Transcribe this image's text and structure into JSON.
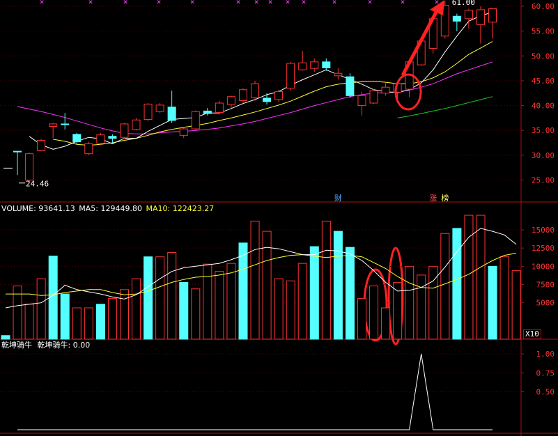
{
  "colors": {
    "up": "#ff3333",
    "down": "#55ffff",
    "ma_white": "#ffffff",
    "ma_yellow": "#ffff33",
    "ma_magenta": "#ff33ff",
    "ma_green": "#22cc22",
    "axis": "#b01010",
    "annotation": "#ff2222"
  },
  "price_panel": {
    "high_label": "61.00",
    "low_label": "24.46",
    "y_ticks": [
      "60.00",
      "55.00",
      "50.00",
      "45.00",
      "40.00",
      "35.00",
      "30.00",
      "25.00"
    ],
    "markers": [
      {
        "text": "财",
        "index": 27,
        "color": "#55aaff"
      },
      {
        "text": "涨",
        "index": 35,
        "color": "#ff5555"
      },
      {
        "text": "榜",
        "index": 36,
        "color": "#ffff66"
      }
    ]
  },
  "volume_panel": {
    "label": "VOLUME:",
    "volume": "93641.13",
    "ma5_label": "MA5:",
    "ma5": "129449.80",
    "ma10_label": "MA10:",
    "ma10": "122423.27",
    "y_ticks": [
      "15000",
      "12500",
      "10000",
      "7500",
      "5000"
    ],
    "unit": "X10"
  },
  "indicator_panel": {
    "name": "乾坤骑牛",
    "name2": "乾坤骑牛:",
    "value": "0.00",
    "y_ticks": [
      "1.00",
      "0.75",
      "0.50"
    ]
  },
  "chart_data": [
    {
      "type": "candlestick",
      "title": "",
      "ylim": [
        23,
        62
      ],
      "series": [
        {
          "o": 30.8,
          "h": 30.8,
          "l": 26.0,
          "c": 30.8,
          "up": false
        },
        {
          "o": 25.0,
          "h": 30.5,
          "l": 24.5,
          "c": 30.3,
          "up": true
        },
        {
          "o": 30.9,
          "h": 33.3,
          "l": 30.8,
          "c": 33.0,
          "up": true
        },
        {
          "o": 35.8,
          "h": 36.5,
          "l": 33.5,
          "c": 36.3,
          "up": true
        },
        {
          "o": 36.2,
          "h": 38.5,
          "l": 35.2,
          "c": 36.3,
          "up": false
        },
        {
          "o": 34.2,
          "h": 34.5,
          "l": 32.3,
          "c": 32.7,
          "up": false
        },
        {
          "o": 30.3,
          "h": 32.7,
          "l": 30.0,
          "c": 32.3,
          "up": true
        },
        {
          "o": 32.4,
          "h": 34.5,
          "l": 32.0,
          "c": 34.1,
          "up": true
        },
        {
          "o": 33.8,
          "h": 34.2,
          "l": 32.5,
          "c": 33.4,
          "up": false
        },
        {
          "o": 33.6,
          "h": 36.5,
          "l": 33.3,
          "c": 36.3,
          "up": true
        },
        {
          "o": 35.2,
          "h": 37.5,
          "l": 35.0,
          "c": 37.1,
          "up": true
        },
        {
          "o": 37.2,
          "h": 40.5,
          "l": 36.8,
          "c": 40.3,
          "up": true
        },
        {
          "o": 38.8,
          "h": 40.5,
          "l": 38.5,
          "c": 40.1,
          "up": true
        },
        {
          "o": 39.7,
          "h": 43.0,
          "l": 36.5,
          "c": 37.0,
          "up": false
        },
        {
          "o": 34.0,
          "h": 35.5,
          "l": 33.5,
          "c": 35.3,
          "up": true
        },
        {
          "o": 35.3,
          "h": 39.0,
          "l": 35.0,
          "c": 38.8,
          "up": true
        },
        {
          "o": 38.9,
          "h": 39.5,
          "l": 38.0,
          "c": 38.4,
          "up": false
        },
        {
          "o": 38.6,
          "h": 40.9,
          "l": 38.2,
          "c": 40.5,
          "up": true
        },
        {
          "o": 40.2,
          "h": 42.0,
          "l": 39.5,
          "c": 41.8,
          "up": true
        },
        {
          "o": 41.0,
          "h": 43.5,
          "l": 40.5,
          "c": 43.2,
          "up": true
        },
        {
          "o": 41.6,
          "h": 45.0,
          "l": 41.0,
          "c": 44.4,
          "up": true
        },
        {
          "o": 41.5,
          "h": 42.5,
          "l": 40.2,
          "c": 40.8,
          "up": false
        },
        {
          "o": 41.2,
          "h": 43.2,
          "l": 40.8,
          "c": 42.8,
          "up": true
        },
        {
          "o": 43.5,
          "h": 48.8,
          "l": 43.0,
          "c": 48.5,
          "up": true
        },
        {
          "o": 47.2,
          "h": 51.0,
          "l": 47.0,
          "c": 48.6,
          "up": true
        },
        {
          "o": 47.5,
          "h": 49.5,
          "l": 46.8,
          "c": 48.8,
          "up": true
        },
        {
          "o": 48.8,
          "h": 49.5,
          "l": 47.0,
          "c": 47.6,
          "up": false
        },
        {
          "o": 46.0,
          "h": 47.5,
          "l": 45.2,
          "c": 46.5,
          "up": true
        },
        {
          "o": 45.8,
          "h": 46.5,
          "l": 41.5,
          "c": 42.0,
          "up": false
        },
        {
          "o": 40.0,
          "h": 42.8,
          "l": 38.0,
          "c": 42.0,
          "up": true
        },
        {
          "o": 40.5,
          "h": 43.3,
          "l": 40.3,
          "c": 43.0,
          "up": true
        },
        {
          "o": 42.5,
          "h": 44.5,
          "l": 42.0,
          "c": 43.7,
          "up": true
        },
        {
          "o": 42.7,
          "h": 44.8,
          "l": 40.5,
          "c": 44.4,
          "up": true
        },
        {
          "o": 43.3,
          "h": 49.0,
          "l": 41.7,
          "c": 48.8,
          "up": true
        },
        {
          "o": 48.2,
          "h": 53.5,
          "l": 48.0,
          "c": 53.0,
          "up": true
        },
        {
          "o": 51.5,
          "h": 58.0,
          "l": 50.5,
          "c": 57.5,
          "up": true
        },
        {
          "o": 54.0,
          "h": 61.0,
          "l": 53.5,
          "c": 60.2,
          "up": true
        },
        {
          "o": 58.0,
          "h": 58.5,
          "l": 55.0,
          "c": 57.0,
          "up": false
        },
        {
          "o": 57.5,
          "h": 59.5,
          "l": 55.5,
          "c": 59.2,
          "up": true
        },
        {
          "o": 56.3,
          "h": 60.0,
          "l": 52.5,
          "c": 59.3,
          "up": true
        },
        {
          "o": 56.8,
          "h": 59.5,
          "l": 53.5,
          "c": 59.5,
          "up": true
        }
      ],
      "ma_white": [
        null,
        33.8,
        32.1,
        31.2,
        31.8,
        32.8,
        33.6,
        33.3,
        32.3,
        33.4,
        33.4,
        34.8,
        36.0,
        37.2,
        37.4,
        37.6,
        38.5,
        38.5,
        39.4,
        40.4,
        41.2,
        42.2,
        42.8,
        44.1,
        45.2,
        46.2,
        47.2,
        46.2,
        45.3,
        44.3,
        43.2,
        42.8,
        42.6,
        43.2,
        44.6,
        47.2,
        50.8,
        54.0,
        57.0,
        58.1,
        58.8
      ],
      "ma_yellow": [
        null,
        null,
        null,
        33.2,
        32.8,
        32.2,
        32.0,
        32.2,
        32.5,
        33.0,
        33.4,
        34.0,
        34.7,
        35.2,
        35.6,
        36.0,
        36.4,
        37.0,
        37.5,
        38.1,
        38.7,
        39.4,
        40.1,
        40.9,
        41.9,
        42.9,
        43.8,
        44.3,
        44.6,
        44.8,
        44.9,
        44.7,
        44.4,
        44.4,
        44.8,
        45.6,
        46.8,
        48.5,
        50.3,
        51.6,
        52.9
      ],
      "ma_magenta": [
        39.8,
        39.3,
        38.8,
        38.2,
        37.6,
        36.9,
        36.2,
        35.5,
        34.9,
        34.4,
        34.3,
        34.3,
        34.5,
        34.7,
        34.8,
        35.0,
        35.2,
        35.5,
        35.9,
        36.3,
        36.8,
        37.4,
        38.0,
        38.6,
        39.3,
        40.0,
        40.6,
        41.2,
        41.8,
        42.2,
        42.5,
        42.6,
        42.8,
        43.1,
        43.7,
        44.4,
        45.4,
        46.4,
        47.2,
        48.0,
        48.8
      ],
      "ma_green": [
        null,
        null,
        null,
        null,
        null,
        null,
        null,
        null,
        null,
        null,
        null,
        null,
        null,
        null,
        null,
        null,
        null,
        null,
        null,
        null,
        null,
        null,
        null,
        null,
        null,
        null,
        null,
        null,
        null,
        null,
        null,
        null,
        37.5,
        37.9,
        38.4,
        38.9,
        39.4,
        40.0,
        40.6,
        41.2,
        41.8
      ]
    },
    {
      "type": "bar",
      "title": "VOLUME",
      "ylim": [
        0,
        17500
      ],
      "unit": "X10",
      "values": [
        500,
        7300,
        4800,
        8300,
        11400,
        6200,
        4300,
        4300,
        4800,
        5600,
        6800,
        8300,
        11300,
        11300,
        11900,
        7800,
        6900,
        10300,
        9300,
        10400,
        13200,
        16200,
        14800,
        8300,
        8000,
        10400,
        12700,
        16200,
        14800,
        12600,
        5600,
        7300,
        4300,
        7800,
        10000,
        8800,
        10000,
        14500,
        15200,
        17000,
        17000,
        10000,
        11300,
        9400
      ]
    },
    {
      "type": "line",
      "title": "乾坤骑牛",
      "ylim": [
        0,
        1.12
      ],
      "values": [
        0,
        0,
        0,
        0,
        0,
        0,
        0,
        0,
        0,
        0,
        0,
        0,
        0,
        0,
        0,
        0,
        0,
        0,
        0,
        0,
        0,
        0,
        0,
        0,
        0,
        0,
        0,
        0,
        0,
        0,
        0,
        0,
        0,
        0,
        1,
        0,
        0,
        0,
        0,
        0,
        0
      ]
    }
  ],
  "ma_volume": {
    "white": [
      4300,
      4600,
      4800,
      5000,
      6000,
      7400,
      6800,
      6500,
      6200,
      5800,
      5500,
      6100,
      7200,
      8300,
      9300,
      9800,
      10000,
      10200,
      10400,
      10900,
      11500,
      12300,
      12600,
      12400,
      12000,
      11600,
      11600,
      12200,
      12100,
      11700,
      10800,
      9400,
      7800,
      6600,
      6700,
      7100,
      8000,
      9900,
      12000,
      14000,
      15200,
      14800,
      14300,
      13000
    ],
    "yellow": [
      6200,
      6200,
      6200,
      6000,
      6100,
      6400,
      6600,
      6800,
      6800,
      6400,
      6100,
      6200,
      6600,
      7200,
      7800,
      8200,
      8500,
      8600,
      8800,
      9100,
      9600,
      10200,
      10800,
      11200,
      11500,
      11600,
      11400,
      11200,
      11400,
      11500,
      11300,
      10500,
      9700,
      8600,
      7700,
      7100,
      7000,
      7600,
      8200,
      8900,
      9900,
      10800,
      11500,
      11800
    ]
  }
}
